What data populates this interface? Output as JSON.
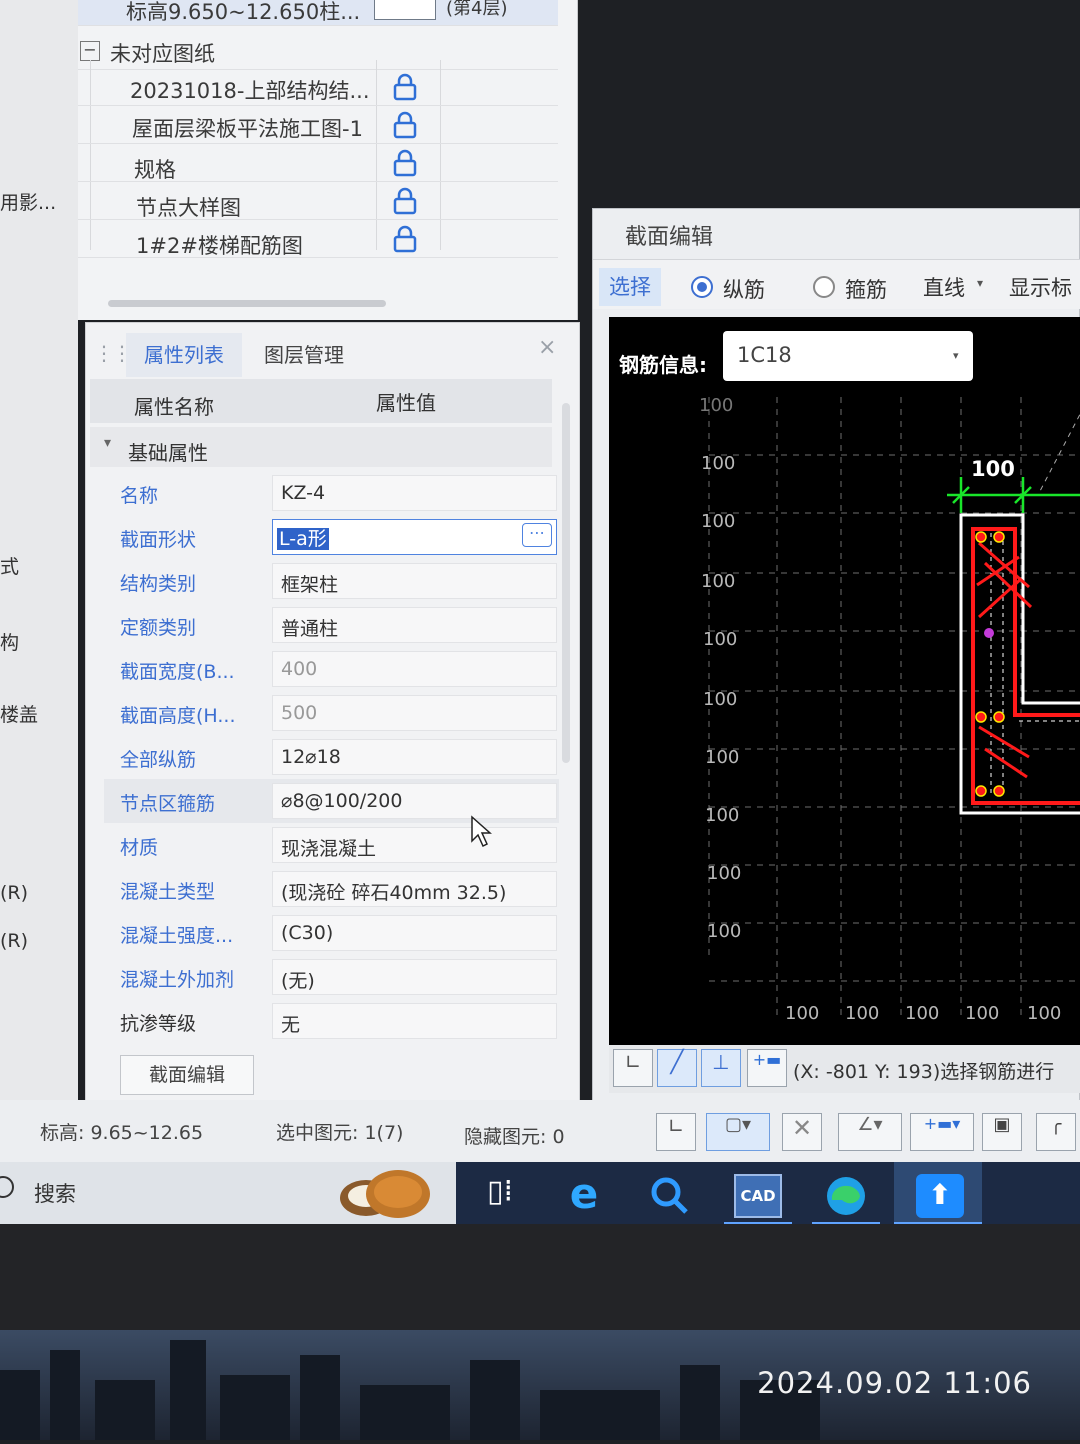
{
  "left_strip": {
    "items": [
      "用影...",
      "式",
      "构",
      "楼盖",
      "(R)",
      "(R)"
    ]
  },
  "drawing_tree": {
    "top_item": {
      "label": "标高9.650~12.650柱...",
      "extra": "(第4层)"
    },
    "group_label": "未对应图纸",
    "collapse_symbol": "−",
    "items": [
      {
        "label": "20231018-上部结构结..."
      },
      {
        "label": "屋面层梁板平法施工图-1"
      },
      {
        "label": "规格"
      },
      {
        "label": "节点大样图"
      },
      {
        "label": "1#2#楼梯配筋图"
      }
    ]
  },
  "properties_panel": {
    "tabs": [
      "属性列表",
      "图层管理"
    ],
    "active_tab": "属性列表",
    "header": {
      "name": "属性名称",
      "value": "属性值"
    },
    "section": "基础属性",
    "rows": [
      {
        "name": "名称",
        "value": "KZ-4"
      },
      {
        "name": "截面形状",
        "value": "L-a形"
      },
      {
        "name": "结构类别",
        "value": "框架柱"
      },
      {
        "name": "定额类别",
        "value": "普通柱"
      },
      {
        "name": "截面宽度(B...",
        "value": "400"
      },
      {
        "name": "截面高度(H...",
        "value": "500"
      },
      {
        "name": "全部纵筋",
        "value": "12⌀18"
      },
      {
        "name": "节点区箍筋",
        "value": "⌀8@100/200"
      },
      {
        "name": "材质",
        "value": "现浇混凝土"
      },
      {
        "name": "混凝土类型",
        "value": "(现浇砼 碎石40mm 32.5)"
      },
      {
        "name": "混凝土强度...",
        "value": "(C30)"
      },
      {
        "name": "混凝土外加剂",
        "value": "(无)"
      },
      {
        "name": "抗渗等级",
        "value": "无"
      }
    ],
    "section_edit_button": "截面编辑"
  },
  "section_editor": {
    "title": "截面编辑",
    "toolbar": {
      "select": "选择",
      "longitudinal": "纵筋",
      "stirrup": "箍筋",
      "line": "直线",
      "display": "显示标"
    },
    "rebar_info_label": "钢筋信息:",
    "rebar_info_value": "1C18",
    "grid_labels_left": [
      "100",
      "100",
      "100",
      "100",
      "100",
      "100",
      "100",
      "100",
      "100",
      "100"
    ],
    "grid_labels_bottom": [
      "100",
      "100",
      "100",
      "100",
      "100"
    ],
    "dimension_label": "100",
    "coords_text": "(X: -801 Y: 193)选择钢筋进行"
  },
  "status_bar": {
    "elevation": "标高: 9.65~12.65",
    "selected": "选中图元: 1(7)",
    "hidden": "隐藏图元: 0"
  },
  "taskbar": {
    "search": "搜索"
  },
  "timestamp": "2024.09.02  11:06",
  "colors": {
    "accent_blue": "#3d6fd1",
    "rebar_red": "#ff1a1a",
    "dim_green": "#19e62a",
    "taskbar_dark": "#1c2a44"
  }
}
